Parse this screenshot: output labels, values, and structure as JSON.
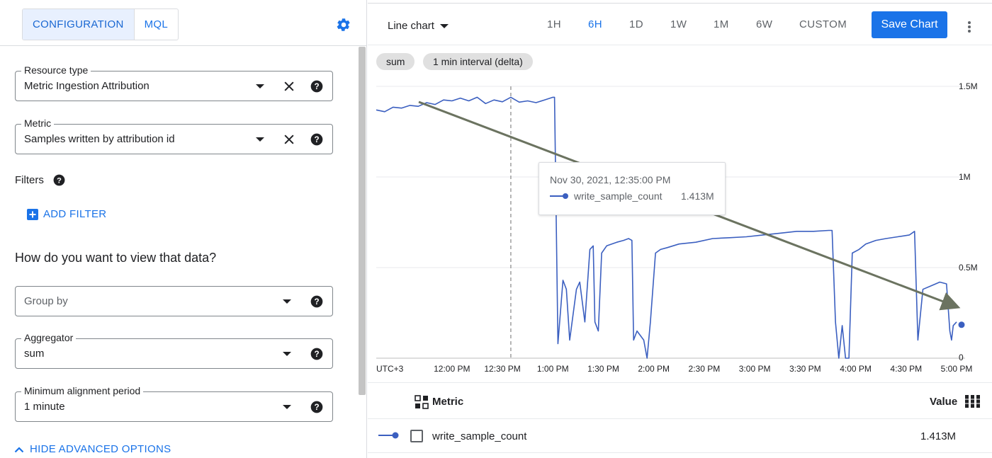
{
  "left_panel": {
    "tabs": [
      {
        "label": "CONFIGURATION",
        "active": true
      },
      {
        "label": "MQL",
        "active": false
      }
    ],
    "resource_type": {
      "label": "Resource type",
      "value": "Metric Ingestion Attribution"
    },
    "metric": {
      "label": "Metric",
      "value": "Samples written by attribution id"
    },
    "filters_label": "Filters",
    "add_filter_label": "ADD FILTER",
    "view_question": "How do you want to view that data?",
    "group_by": {
      "placeholder": "Group by"
    },
    "aggregator": {
      "label": "Aggregator",
      "value": "sum"
    },
    "min_alignment": {
      "label": "Minimum alignment period",
      "value": "1 minute"
    },
    "hide_advanced_label": "HIDE ADVANCED OPTIONS"
  },
  "right_panel": {
    "chart_type_label": "Line chart",
    "time_ranges": [
      "1H",
      "6H",
      "1D",
      "1W",
      "1M",
      "6W",
      "CUSTOM"
    ],
    "active_range": "6H",
    "save_chart_label": "Save Chart",
    "chips": [
      "sum",
      "1 min interval (delta)"
    ],
    "tooltip": {
      "time": "Nov 30, 2021, 12:35:00 PM",
      "series": "write_sample_count",
      "value": "1.413M"
    },
    "table": {
      "metric_header": "Metric",
      "value_header": "Value",
      "rows": [
        {
          "metric": "write_sample_count",
          "value": "1.413M"
        }
      ]
    }
  },
  "colors": {
    "accent": "#1a73e8",
    "series": "#3b5fc0",
    "annotation_arrow": "#6b7360"
  },
  "chart_data": {
    "type": "line",
    "timezone_label": "UTC+3",
    "x_ticks": [
      "12:00 PM",
      "12:30 PM",
      "1:00 PM",
      "1:30 PM",
      "2:00 PM",
      "2:30 PM",
      "3:00 PM",
      "3:30 PM",
      "4:00 PM",
      "4:30 PM",
      "5:00 PM"
    ],
    "y_ticks": [
      "0",
      "0.5M",
      "1M",
      "1.5M"
    ],
    "ylim": [
      0,
      1500000
    ],
    "x_range_minutes": [
      -45,
      300
    ],
    "cursor_minute": 35,
    "series": [
      {
        "name": "write_sample_count",
        "points": [
          [
            -45,
            1370000
          ],
          [
            -40,
            1360000
          ],
          [
            -35,
            1385000
          ],
          [
            -30,
            1380000
          ],
          [
            -25,
            1395000
          ],
          [
            -20,
            1390000
          ],
          [
            -15,
            1410000
          ],
          [
            -10,
            1400000
          ],
          [
            -5,
            1425000
          ],
          [
            0,
            1420000
          ],
          [
            5,
            1435000
          ],
          [
            10,
            1420000
          ],
          [
            15,
            1440000
          ],
          [
            20,
            1405000
          ],
          [
            25,
            1425000
          ],
          [
            30,
            1415000
          ],
          [
            35,
            1440000
          ],
          [
            40,
            1413000
          ],
          [
            45,
            1420000
          ],
          [
            50,
            1410000
          ],
          [
            55,
            1425000
          ],
          [
            60,
            1440000
          ],
          [
            61,
            1440000
          ],
          [
            63,
            80000
          ],
          [
            66,
            430000
          ],
          [
            68,
            380000
          ],
          [
            70,
            100000
          ],
          [
            74,
            380000
          ],
          [
            76,
            420000
          ],
          [
            79,
            200000
          ],
          [
            82,
            600000
          ],
          [
            84,
            620000
          ],
          [
            85,
            200000
          ],
          [
            87,
            150000
          ],
          [
            89,
            580000
          ],
          [
            92,
            620000
          ],
          [
            95,
            630000
          ],
          [
            98,
            640000
          ],
          [
            102,
            650000
          ],
          [
            105,
            660000
          ],
          [
            107,
            650000
          ],
          [
            108,
            100000
          ],
          [
            110,
            150000
          ],
          [
            114,
            100000
          ],
          [
            116,
            0
          ],
          [
            118,
            200000
          ],
          [
            121,
            580000
          ],
          [
            124,
            600000
          ],
          [
            128,
            610000
          ],
          [
            135,
            630000
          ],
          [
            145,
            640000
          ],
          [
            155,
            660000
          ],
          [
            165,
            665000
          ],
          [
            175,
            670000
          ],
          [
            185,
            680000
          ],
          [
            195,
            690000
          ],
          [
            205,
            700000
          ],
          [
            215,
            700000
          ],
          [
            224,
            705000
          ],
          [
            226,
            705000
          ],
          [
            228,
            200000
          ],
          [
            230,
            0
          ],
          [
            232,
            180000
          ],
          [
            234,
            0
          ],
          [
            236,
            0
          ],
          [
            238,
            580000
          ],
          [
            242,
            600000
          ],
          [
            246,
            630000
          ],
          [
            252,
            650000
          ],
          [
            258,
            660000
          ],
          [
            265,
            670000
          ],
          [
            272,
            680000
          ],
          [
            275,
            700000
          ],
          [
            277,
            100000
          ],
          [
            280,
            380000
          ],
          [
            285,
            400000
          ],
          [
            290,
            420000
          ],
          [
            294,
            410000
          ],
          [
            296,
            150000
          ],
          [
            297,
            100000
          ],
          [
            298,
            180000
          ],
          [
            300,
            200000
          ]
        ],
        "last_value": 1413000
      }
    ]
  }
}
